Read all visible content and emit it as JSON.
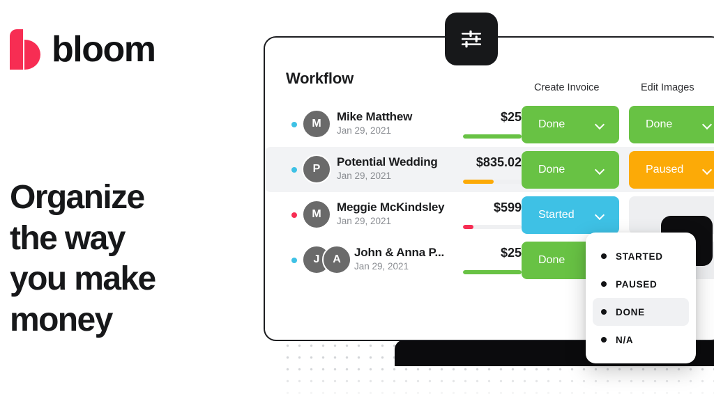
{
  "brand": {
    "logo_icon": "bloom-b-icon",
    "name": "bloom",
    "accent_color": "#F72D53"
  },
  "headline": {
    "line1": "Organize",
    "line2": "the way",
    "line3": "you make",
    "line4": "money"
  },
  "toolbar": {
    "sliders_icon": "sliders-icon"
  },
  "app": {
    "title": "Workflow",
    "columns": [
      {
        "label": "Create Invoice"
      },
      {
        "label": "Edit Images"
      }
    ],
    "rows": [
      {
        "dot_color": "#3EC1E5",
        "avatars": [
          "M"
        ],
        "name": "Mike Matthew",
        "date": "Jan 29, 2021",
        "amount": "$25",
        "progress_percent": 100,
        "progress_color": "#68C244",
        "create_invoice": {
          "label": "Done",
          "state": "green"
        },
        "edit_images": {
          "label": "Done",
          "state": "green"
        }
      },
      {
        "dot_color": "#3EC1E5",
        "avatars": [
          "P"
        ],
        "name": "Potential Wedding",
        "date": "Jan 29, 2021",
        "amount": "$835.02",
        "progress_percent": 52,
        "progress_color": "#FCAA07",
        "create_invoice": {
          "label": "Done",
          "state": "green"
        },
        "edit_images": {
          "label": "Paused",
          "state": "orange"
        }
      },
      {
        "dot_color": "#F72D53",
        "avatars": [
          "M"
        ],
        "name": "Meggie McKindsley",
        "date": "Jan 29, 2021",
        "amount": "$599",
        "progress_percent": 18,
        "progress_color": "#F72D53",
        "create_invoice": {
          "label": "Started",
          "state": "cyan"
        },
        "edit_images": {
          "label": "",
          "state": "empty"
        }
      },
      {
        "dot_color": "#3EC1E5",
        "avatars": [
          "J",
          "A"
        ],
        "name": "John & Anna P...",
        "date": "Jan 29, 2021",
        "amount": "$25",
        "progress_percent": 100,
        "progress_color": "#68C244",
        "create_invoice": {
          "label": "Done",
          "state": "green"
        },
        "edit_images": {
          "label": "",
          "state": "empty"
        }
      }
    ]
  },
  "dropdown": {
    "items": [
      {
        "label": "STARTED",
        "selected": false
      },
      {
        "label": "PAUSED",
        "selected": false
      },
      {
        "label": "DONE",
        "selected": true
      },
      {
        "label": "N/A",
        "selected": false
      }
    ]
  }
}
